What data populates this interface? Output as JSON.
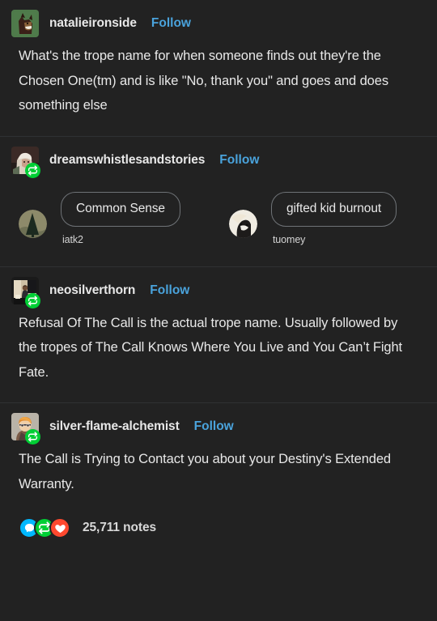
{
  "theme": {
    "background": "#222222",
    "text": "#e8e8e8",
    "link_blue": "#4aa3dc",
    "divider": "#2f3133",
    "reblog_green": "#00cf35",
    "note_blue": "#00b8ff",
    "note_green": "#00cf35",
    "note_red": "#ff492f"
  },
  "follow_label": "Follow",
  "blocks": [
    {
      "username": "natalieironside",
      "avatar": "wolf-green-avatar",
      "reblogged": false,
      "text": "What's the trope name for when someone finds out they're the Chosen One(tm) and is like \"No, thank you\" and goes and does something else"
    },
    {
      "username": "dreamswhistlesandstories",
      "avatar": "woman-white-hair-avatar",
      "reblogged": true,
      "tag_replies": [
        {
          "tag": "Common Sense",
          "author": "iatk2",
          "avatar": "dark-tree-avatar"
        },
        {
          "tag": "gifted kid burnout",
          "author": "tuomey",
          "avatar": "dog-white-avatar"
        }
      ]
    },
    {
      "username": "neosilverthorn",
      "avatar": "person-desk-avatar",
      "reblogged": true,
      "text": "Refusal Of The Call is the actual trope name.  Usually followed by the tropes of The Call Knows Where You Live and You Can’t Fight Fate."
    },
    {
      "username": "silver-flame-alchemist",
      "avatar": "anime-orange-hair-avatar",
      "reblogged": true,
      "text": "The Call is Trying to Contact you about your Destiny's Extended Warranty."
    }
  ],
  "footer": {
    "notes_count": "25,711 notes",
    "icons": [
      "reply-icon",
      "reblog-icon",
      "like-icon"
    ]
  }
}
